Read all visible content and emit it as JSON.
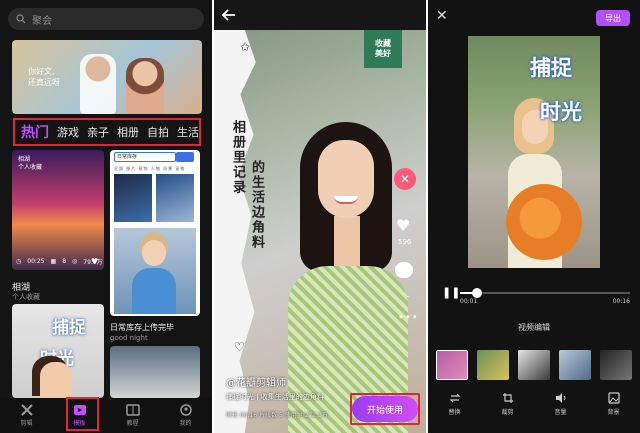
{
  "panel1": {
    "search_placeholder": "聚会",
    "banner_text": [
      "你好文,",
      "还真远呀"
    ],
    "tabs": [
      "热门",
      "游戏",
      "亲子",
      "相册",
      "自拍",
      "生活"
    ],
    "card1": {
      "title_lines": [
        "相湖",
        "个人收藏"
      ],
      "duration": "00:25",
      "clips": "8",
      "uses": "79.0万",
      "label": "相湖",
      "sublabel": "个人收藏"
    },
    "card2": {
      "search_text": "日常库存",
      "categories": "全部 图片 视频 人物 风景 宠物",
      "label": "日常库存上传完毕",
      "sublabel": "good night"
    },
    "card3": {
      "calligraphy_top": "捕捉",
      "calligraphy_bottom": "时光"
    },
    "nav": [
      {
        "label": "剪辑",
        "active": false
      },
      {
        "label": "模板",
        "active": true
      },
      {
        "label": "教程",
        "active": false
      },
      {
        "label": "我的",
        "active": false
      }
    ]
  },
  "panel2": {
    "stamp_lines": [
      "收藏",
      "美好"
    ],
    "vertical_text_1": "相册里记录",
    "vertical_text_2": "的生活边角料",
    "like_count": "596",
    "author": "@花瓣剪辑师",
    "description": "捕捉时光 | 收集生活里的边角料",
    "meta": "时长 00:16   片段数 5   使用量 272.3万",
    "start_button": "开始使用"
  },
  "panel3": {
    "export_button": "导出",
    "calligraphy_top": "捕捉",
    "calligraphy_bottom": "时光",
    "time_current": "00:01",
    "time_total": "00:16",
    "progress": 0.1,
    "section_title": "视频编辑",
    "tools": [
      "替换",
      "裁剪",
      "音量",
      "背景"
    ]
  },
  "colors": {
    "accent": "#c54cff",
    "highlight_box": "#e0243a",
    "button_gradient_start": "#9b3cf2",
    "button_gradient_end": "#d24df5"
  }
}
